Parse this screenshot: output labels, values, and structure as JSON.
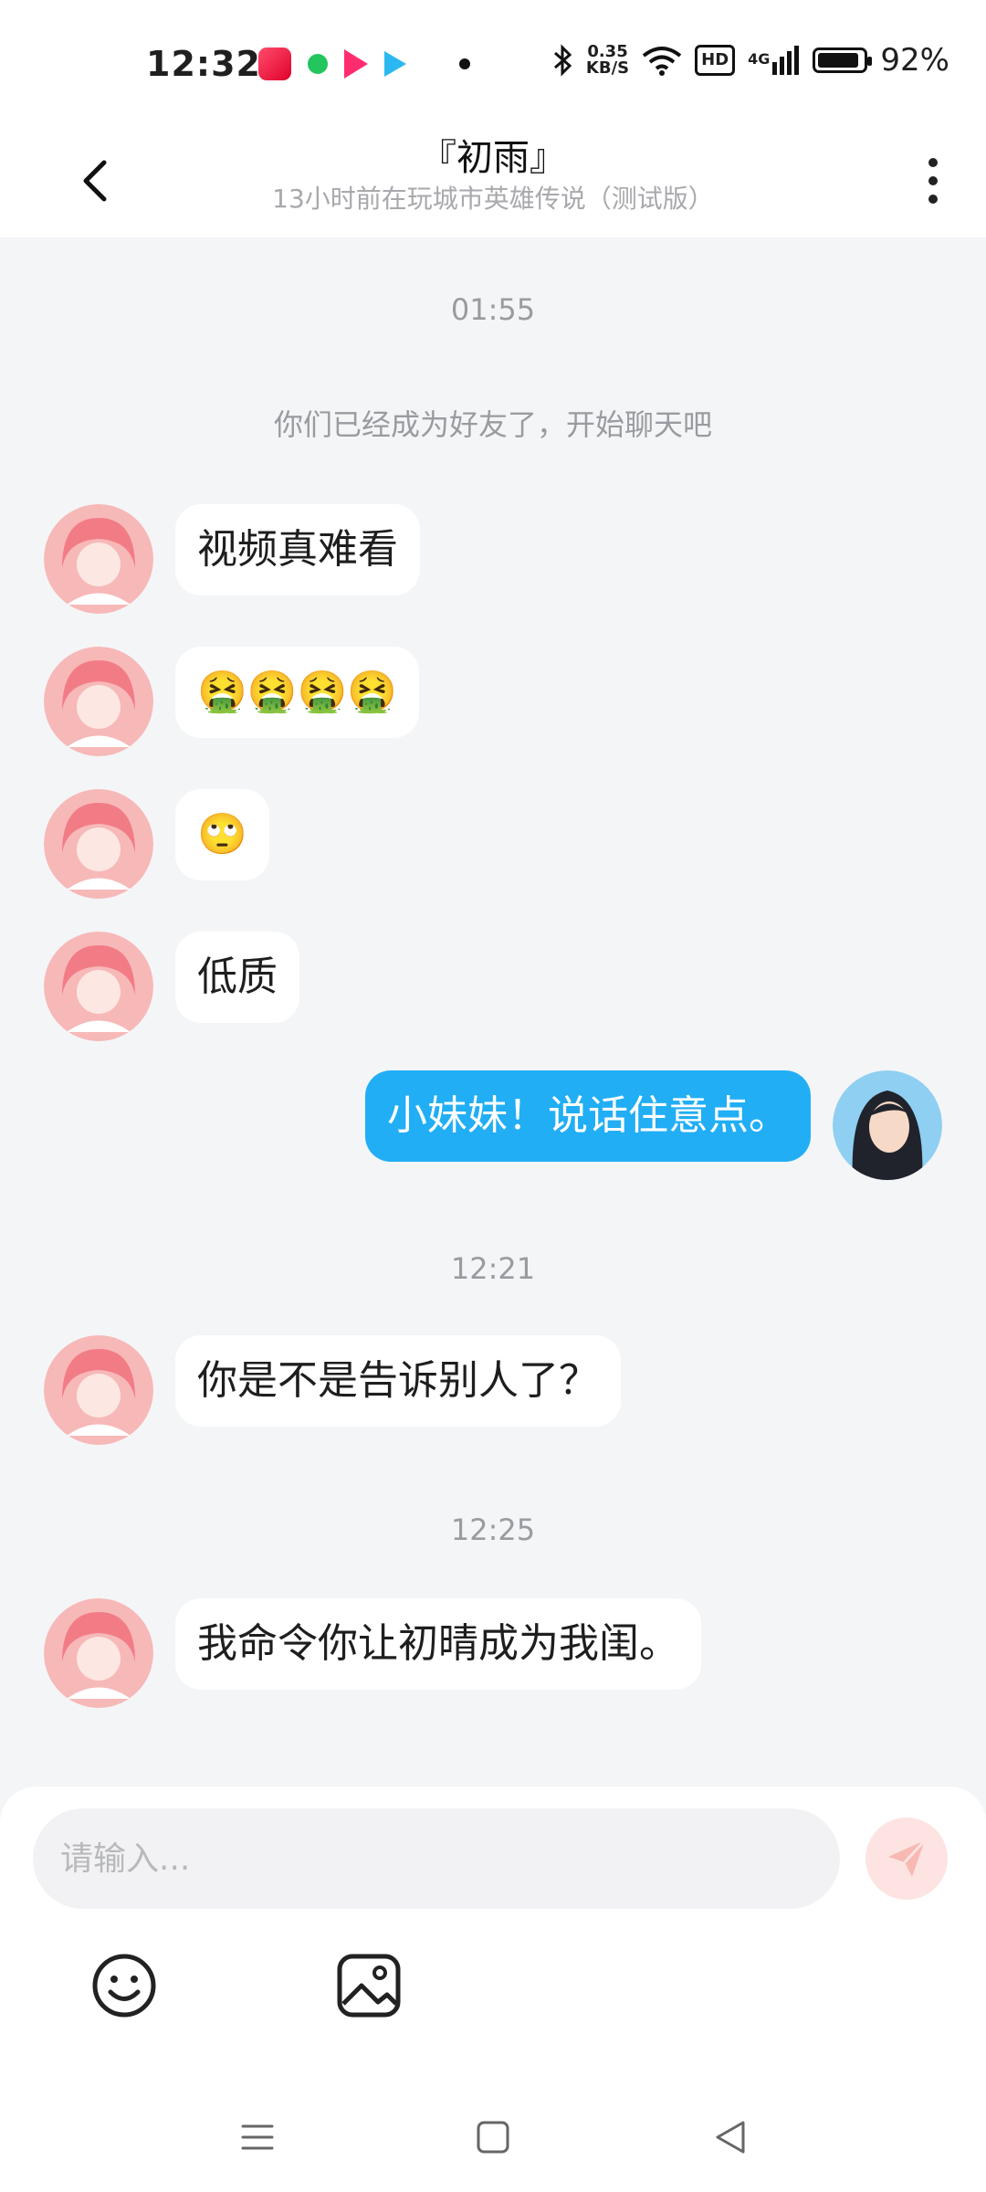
{
  "status_bar": {
    "time": "12:32",
    "net_speed_value": "0.35",
    "net_speed_unit": "KB/S",
    "hd_label": "HD",
    "signal_label": "4G",
    "battery_percent": "92%",
    "battery_level": 0.92
  },
  "header": {
    "title": "『初雨』",
    "subtitle": "13小时前在玩城市英雄传说（测试版）"
  },
  "messages": [
    {
      "time": "01:55"
    },
    {
      "system": "你们已经成为好友了，开始聊天吧"
    },
    {
      "from": "friend",
      "text": "视频真难看"
    },
    {
      "from": "friend",
      "text": "🤮🤮🤮🤮"
    },
    {
      "from": "friend",
      "text": "🙄"
    },
    {
      "from": "friend",
      "text": "低质"
    },
    {
      "from": "me",
      "text": "小妹妹！说话住意点。"
    },
    {
      "time": "12:21"
    },
    {
      "from": "friend",
      "text": "你是不是告诉别人了？"
    },
    {
      "time": "12:25"
    },
    {
      "from": "friend",
      "text": "我命令你让初晴成为我闺。"
    }
  ],
  "input": {
    "placeholder": "请输入..."
  },
  "icons": {
    "back": "chevron-left-icon",
    "more": "more-vertical-icon",
    "send": "paper-plane-icon",
    "emoji": "smiley-icon",
    "image": "image-icon",
    "nav_menu": "menu-icon",
    "nav_home": "square-home-icon",
    "nav_back": "triangle-back-icon"
  },
  "colors": {
    "my_bubble": "#21aef5",
    "friend_bubble": "#ffffff",
    "send_button": "#fde4e2",
    "background": "#f4f5f7"
  }
}
